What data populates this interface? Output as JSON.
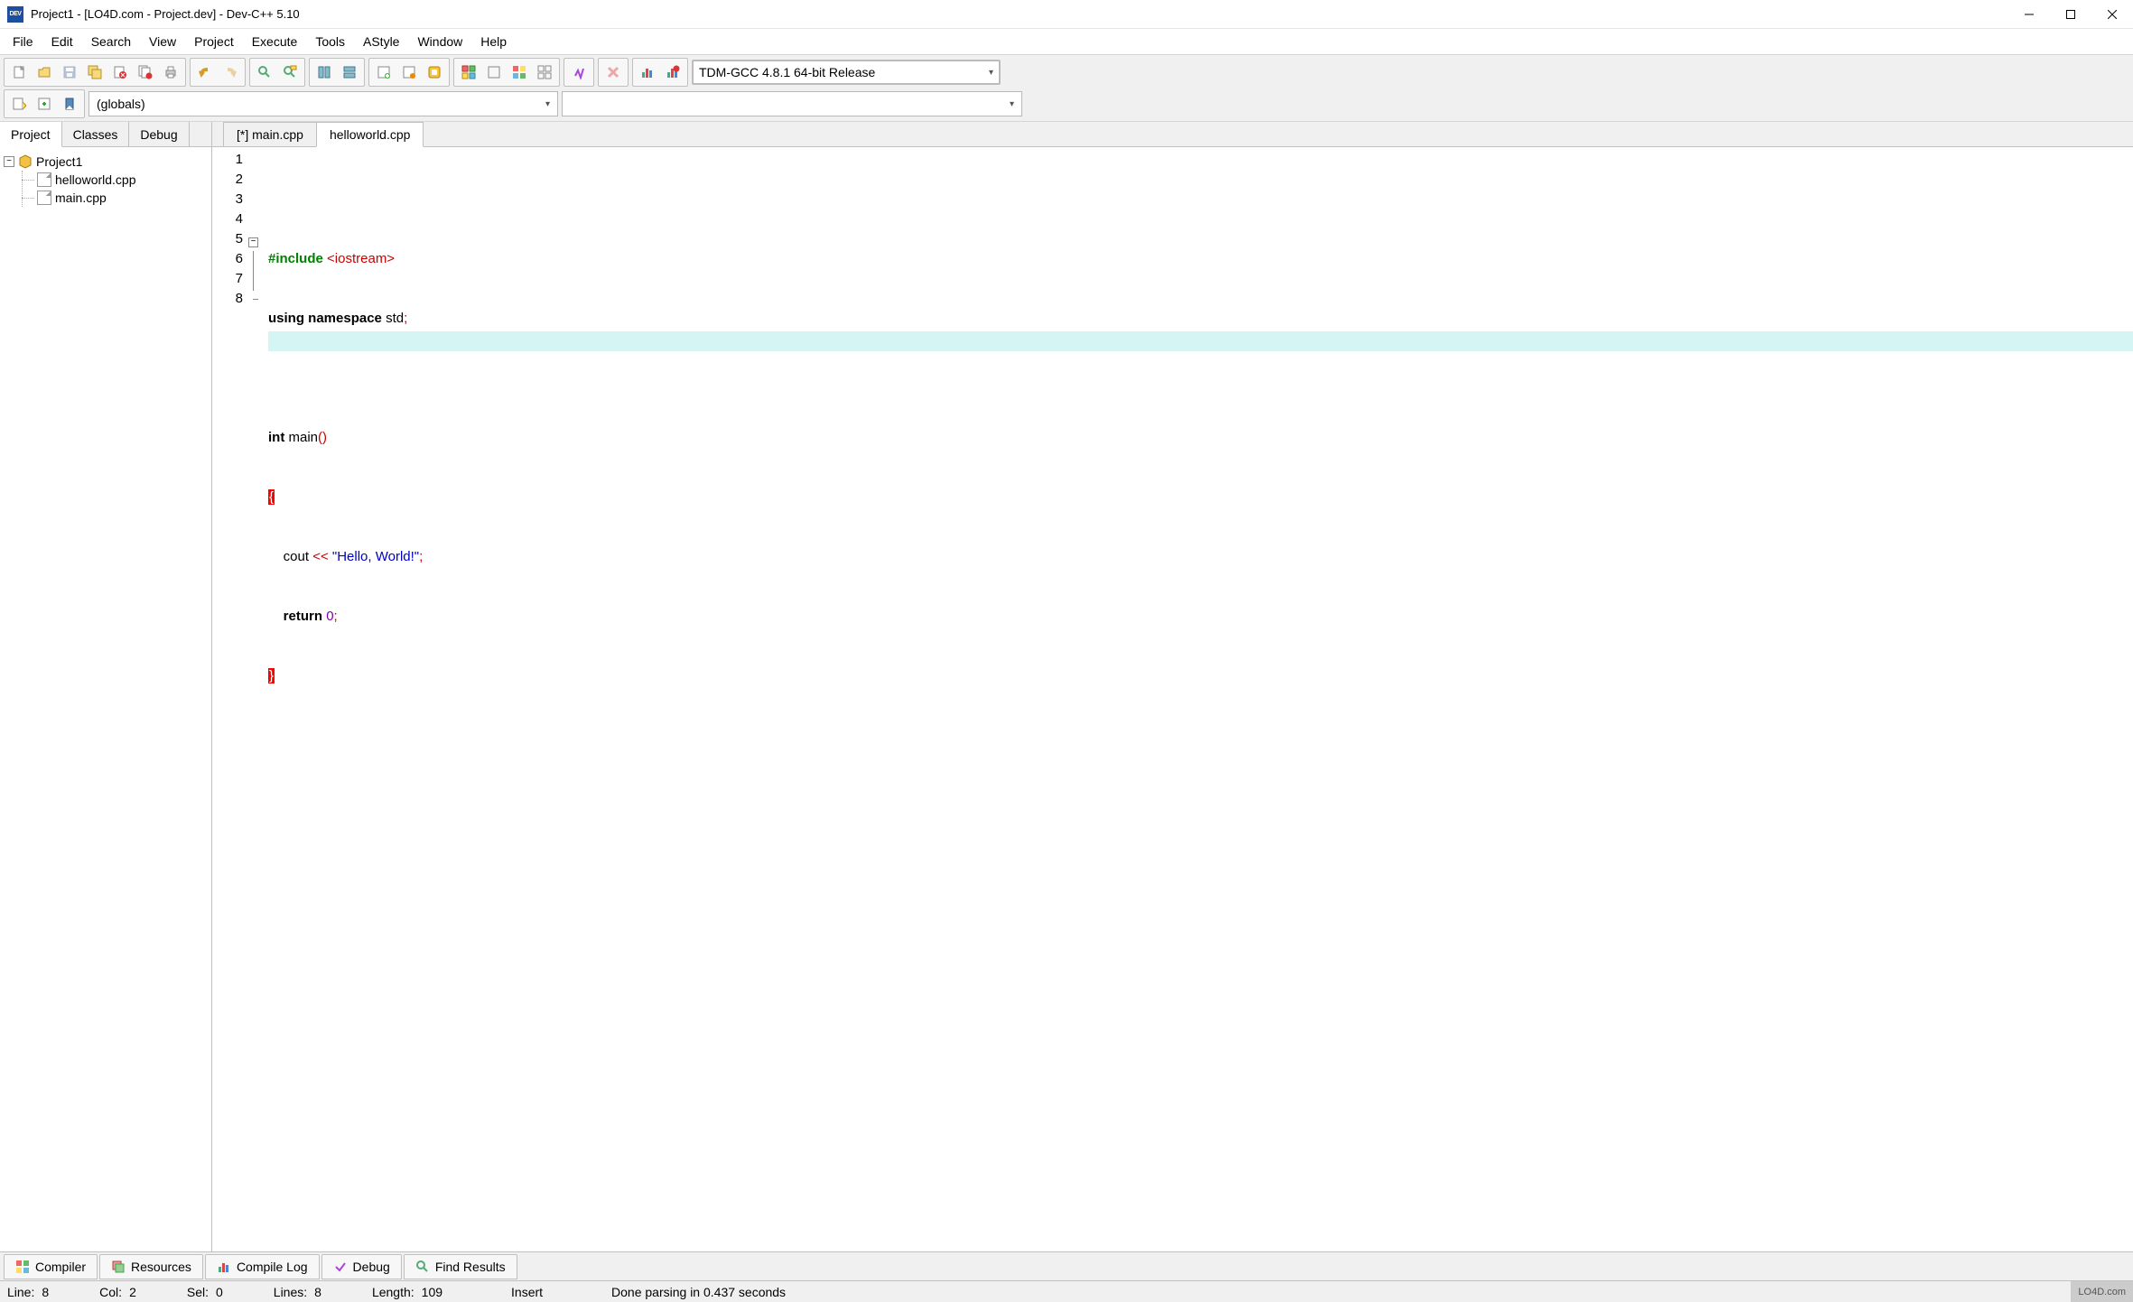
{
  "title": "Project1 - [LO4D.com - Project.dev] - Dev-C++ 5.10",
  "menu": [
    "File",
    "Edit",
    "Search",
    "View",
    "Project",
    "Execute",
    "Tools",
    "AStyle",
    "Window",
    "Help"
  ],
  "compiler_combo": "TDM-GCC 4.8.1 64-bit Release",
  "scope_combo": "(globals)",
  "side_tabs": [
    "Project",
    "Classes",
    "Debug"
  ],
  "tree": {
    "root": "Project1",
    "files": [
      "helloworld.cpp",
      "main.cpp"
    ]
  },
  "file_tabs": [
    {
      "label": "[*] main.cpp",
      "active": false
    },
    {
      "label": "helloworld.cpp",
      "active": true
    }
  ],
  "code": {
    "lines": [
      "1",
      "2",
      "3",
      "4",
      "5",
      "6",
      "7",
      "8"
    ],
    "l1_a": "#include ",
    "l1_b": "<iostream>",
    "l2_a": "using ",
    "l2_b": "namespace ",
    "l2_c": "std",
    "l2_d": ";",
    "l4_a": "int ",
    "l4_b": "main",
    "l4_c": "()",
    "l5": "{",
    "l6_a": "    cout ",
    "l6_b": "<< ",
    "l6_c": "\"Hello, World!\"",
    "l6_d": ";",
    "l7_a": "    ",
    "l7_b": "return ",
    "l7_c": "0",
    "l7_d": ";",
    "l8": "}"
  },
  "bottom_tabs": [
    {
      "label": "Compiler",
      "icon": "grid"
    },
    {
      "label": "Resources",
      "icon": "stack"
    },
    {
      "label": "Compile Log",
      "icon": "bars"
    },
    {
      "label": "Debug",
      "icon": "check"
    },
    {
      "label": "Find Results",
      "icon": "magnifier"
    }
  ],
  "status": {
    "line_lbl": "Line:",
    "line": "8",
    "col_lbl": "Col:",
    "col": "2",
    "sel_lbl": "Sel:",
    "sel": "0",
    "lines_lbl": "Lines:",
    "lines": "8",
    "length_lbl": "Length:",
    "length": "109",
    "mode": "Insert",
    "msg": "Done parsing in 0.437 seconds",
    "watermark": "LO4D.com"
  }
}
